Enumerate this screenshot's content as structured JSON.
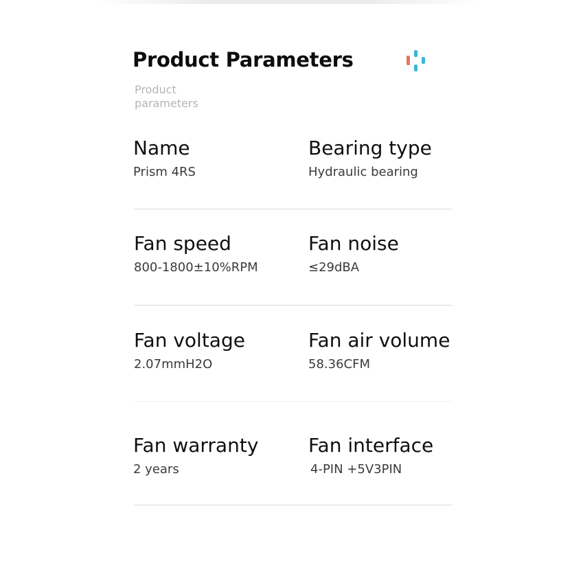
{
  "header": {
    "title": "Product Parameters",
    "subtitle": "Product parameters",
    "logo_colors": [
      "#e07a5f",
      "#3bb5d6"
    ]
  },
  "params": [
    {
      "label": "Name",
      "value": "Prism 4RS"
    },
    {
      "label": "Bearing type",
      "value": "Hydraulic bearing"
    },
    {
      "label": "Fan speed",
      "value": "800-1800±10%RPM"
    },
    {
      "label": "Fan noise",
      "value": "≤29dBA"
    },
    {
      "label": "Fan voltage",
      "value": "2.07mmH2O"
    },
    {
      "label": "Fan air volume",
      "value": "58.36CFM"
    },
    {
      "label": "Fan warranty",
      "value": "2 years"
    },
    {
      "label": "Fan interface",
      "value": "4-PIN +5V3PIN"
    }
  ]
}
